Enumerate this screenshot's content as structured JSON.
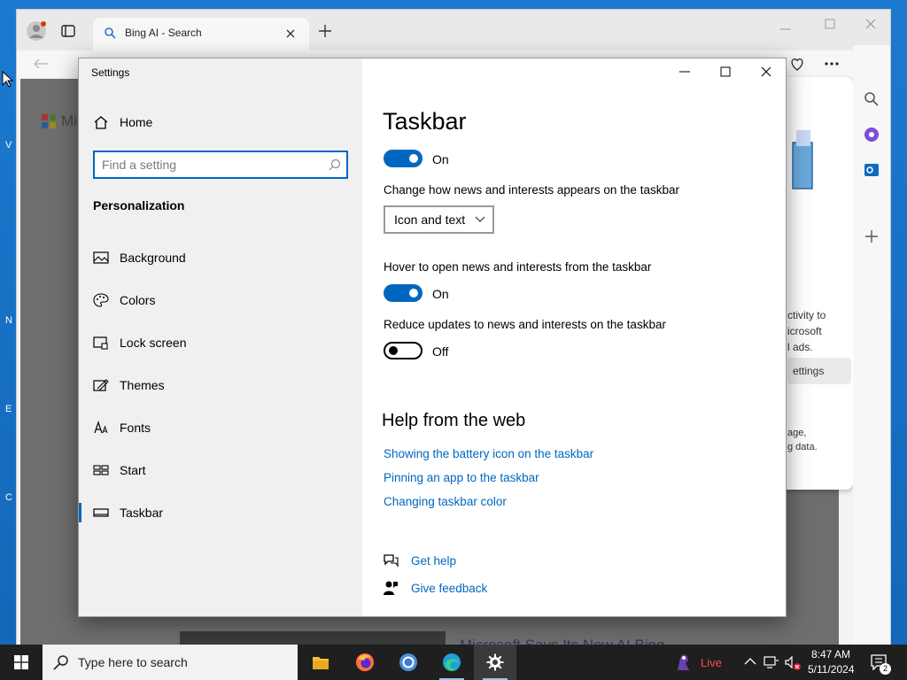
{
  "desktop": {
    "edge_letters": [
      "V",
      "N",
      "E",
      "C"
    ]
  },
  "browser": {
    "tab_title": "Bing AI - Search",
    "background_card": {
      "lines": [
        "ctivity to",
        "icrosoft",
        "l ads."
      ],
      "settings_label": "ettings",
      "footer_lines": [
        "age,",
        "g data."
      ]
    },
    "page_heading_partial": "Microsoft Says Its New AI Bing",
    "logo_partial": "Mi"
  },
  "settings": {
    "window_title": "Settings",
    "sidebar": {
      "home_label": "Home",
      "search_placeholder": "Find a setting",
      "section_title": "Personalization",
      "items": [
        {
          "label": "Background",
          "icon": "background-icon"
        },
        {
          "label": "Colors",
          "icon": "palette-icon"
        },
        {
          "label": "Lock screen",
          "icon": "lock-screen-icon"
        },
        {
          "label": "Themes",
          "icon": "themes-icon"
        },
        {
          "label": "Fonts",
          "icon": "fonts-icon"
        },
        {
          "label": "Start",
          "icon": "start-icon"
        },
        {
          "label": "Taskbar",
          "icon": "taskbar-icon",
          "active": true
        }
      ]
    },
    "main": {
      "page_title": "Taskbar",
      "toggle1_state": "On",
      "news_label": "Change how news and interests appears on the taskbar",
      "news_dropdown_value": "Icon and text",
      "hover_label": "Hover to open news and interests from the taskbar",
      "hover_state": "On",
      "reduce_label": "Reduce updates to news and interests on the taskbar",
      "reduce_state": "Off",
      "help_title": "Help from the web",
      "help_links": [
        "Showing the battery icon on the taskbar",
        "Pinning an app to the taskbar",
        "Changing taskbar color"
      ],
      "get_help": "Get help",
      "give_feedback": "Give feedback"
    }
  },
  "taskbar": {
    "search_placeholder": "Type here to search",
    "live_label": "Live",
    "time": "8:47 AM",
    "date": "5/11/2024",
    "notification_count": "2"
  },
  "colors": {
    "accent": "#0067c0",
    "desktop": "#1b7ad0",
    "taskbar": "#1f1f1f"
  }
}
